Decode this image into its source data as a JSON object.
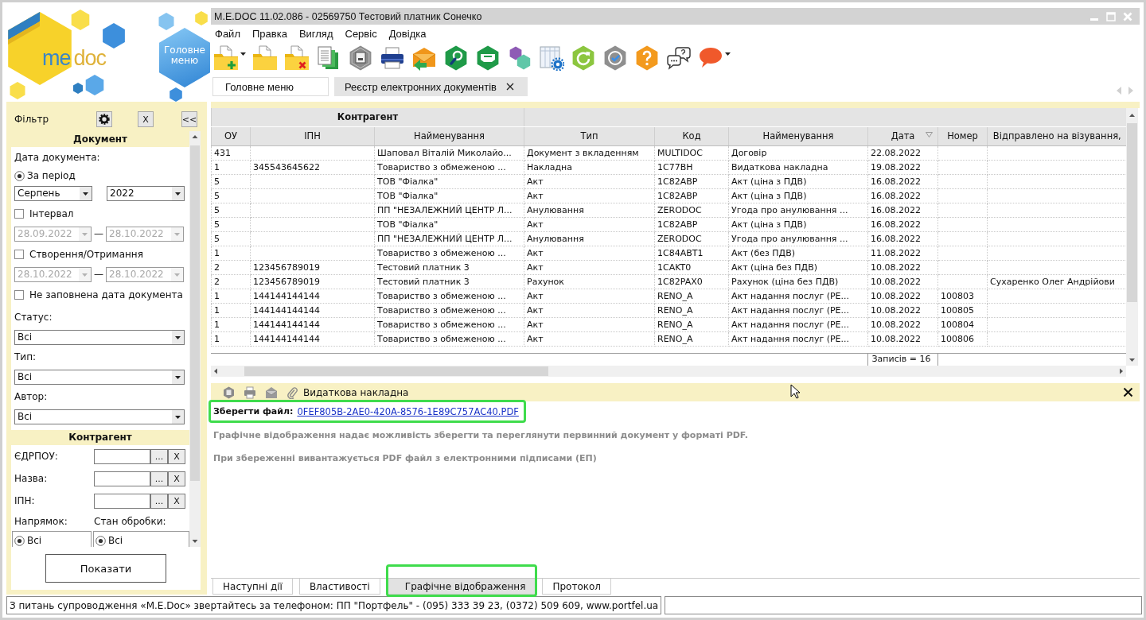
{
  "logo": {
    "words": [
      "me",
      "doc"
    ]
  },
  "main_menu_button": {
    "label": "Головне меню"
  },
  "filter": {
    "title": "Фільтр",
    "clear_button": "X",
    "collapse_button": "<<",
    "document_section": {
      "title": "Документ",
      "date_label": "Дата документа:",
      "period": {
        "label": "За період",
        "selected": true,
        "month": "Серпень",
        "year": "2022"
      },
      "ranges": [
        {
          "label": "Інтервал",
          "checked": false,
          "disabled": true,
          "from": "28.09.2022",
          "separator": "—",
          "to": "28.10.2022"
        },
        {
          "label": "Створення/Отримання",
          "checked": false,
          "disabled": true,
          "from": "28.10.2022",
          "separator": "—",
          "to": "28.10.2022"
        }
      ],
      "empty_date": {
        "label": "Не заповнена дата документа",
        "checked": false
      },
      "selects": [
        {
          "label": "Статус:",
          "value": "Всі"
        },
        {
          "label": "Тип:",
          "value": "Всі"
        },
        {
          "label": "Автор:",
          "value": "Всі"
        }
      ]
    },
    "counterparty_section": {
      "title": "Контрагент",
      "fields": [
        {
          "label": "ЄДРПОУ:",
          "browse_button": "...",
          "clear_button": "X"
        },
        {
          "label": "Назва:",
          "browse_button": "...",
          "clear_button": "X"
        },
        {
          "label": "ІПН:",
          "browse_button": "...",
          "clear_button": "X"
        }
      ],
      "option_groups": [
        {
          "label": "Напрямок:",
          "options": [
            {
              "label": "Всі",
              "selected": true
            }
          ]
        },
        {
          "label": "Стан обробки:",
          "options": [
            {
              "label": "Всі",
              "selected": true
            }
          ]
        }
      ]
    },
    "show_button": "Показати"
  },
  "window": {
    "title": "M.E.DOC 11.02.086 - 02569750 Тестовий платник Сонечко"
  },
  "menu": [
    "Файл",
    "Правка",
    "Вигляд",
    "Сервіс",
    "Довідка"
  ],
  "tabs": [
    {
      "label": "Головне меню",
      "selected": false,
      "closable": false
    },
    {
      "label": "Реєстр електронних документів",
      "selected": true,
      "closable": true
    }
  ],
  "table": {
    "column_groups": [
      {
        "label": "Контрагент",
        "columns": [
          {
            "label": "ОУ",
            "sorted": false
          },
          {
            "label": "ІПН",
            "sorted": false
          },
          {
            "label": "Найменування",
            "sorted": false
          }
        ]
      },
      {
        "columns": [
          {
            "label": "Тип",
            "sorted": false
          },
          {
            "label": "Код",
            "sorted": false
          },
          {
            "label": "Найменування",
            "sorted": false
          },
          {
            "label": "Дата",
            "sorted": true
          },
          {
            "label": "Номер",
            "sorted": false
          },
          {
            "label": "Відправлено на візування,",
            "sorted": false
          }
        ]
      }
    ],
    "rows": [
      {
        "column_1": "431",
        "counterparty_name": "Шаповал Віталій Миколайо...",
        "type": "Документ з вкладенням",
        "code": "MULTIDOC",
        "document_name": "Договір",
        "date": "22.08.2022"
      },
      {
        "column_1": "1",
        "ipn": "345543645622",
        "counterparty_name": "Товариство з обмеженою ...",
        "type": "Накладна",
        "code": "1C77BH",
        "document_name": "Видаткова накладна",
        "date": "19.08.2022"
      },
      {
        "column_1": "5",
        "counterparty_name": "ТОВ \"Фіалка\"",
        "type": "Акт",
        "code": "1C82ABP",
        "document_name": "Акт (ціна з ПДВ)",
        "date": "16.08.2022"
      },
      {
        "column_1": "5",
        "counterparty_name": "ТОВ \"Фіалка\"",
        "type": "Акт",
        "code": "1C82ABP",
        "document_name": "Акт (ціна з ПДВ)",
        "date": "16.08.2022"
      },
      {
        "column_1": "5",
        "counterparty_name": "ПП \"НЕЗАЛЕЖНИЙ ЦЕНТР Л...",
        "type": "Анулювання",
        "code": "ZERODOC",
        "document_name": "Угода про анулювання ...",
        "date": "16.08.2022"
      },
      {
        "column_1": "5",
        "counterparty_name": "ТОВ \"Фіалка\"",
        "type": "Акт",
        "code": "1C82ABP",
        "document_name": "Акт (ціна з ПДВ)",
        "date": "16.08.2022"
      },
      {
        "column_1": "5",
        "counterparty_name": "ПП \"НЕЗАЛЕЖНИЙ ЦЕНТР Л...",
        "type": "Анулювання",
        "code": "ZERODOC",
        "document_name": "Угода про анулювання ...",
        "date": "16.08.2022"
      },
      {
        "column_1": "1",
        "counterparty_name": "Товариство з обмеженою ...",
        "type": "Акт",
        "code": "1C84ABT1",
        "document_name": "Акт (без ПДВ)",
        "date": "11.08.2022"
      },
      {
        "column_1": "2",
        "ipn": "123456789019",
        "counterparty_name": "Тестовий платник 3",
        "type": "Акт",
        "code": "1CAKT0",
        "document_name": "Акт (ціна без ПДВ)",
        "date": "10.08.2022"
      },
      {
        "column_1": "2",
        "ipn": "123456789019",
        "counterparty_name": "Тестовий платник 3",
        "type": "Рахунок",
        "code": "1C82PAX0",
        "document_name": "Рахунок (ціна без ПДВ)",
        "date": "10.08.2022",
        "sent_for_approval": "Сухаренко Олег Андрійови"
      },
      {
        "column_1": "1",
        "ipn": "144144144144",
        "counterparty_name": "Товариство з обмеженою ...",
        "type": "Акт",
        "code": "RENO_A",
        "document_name": "Акт надання послуг (РЕ...",
        "date": "10.08.2022",
        "number": "100803"
      },
      {
        "column_1": "1",
        "ipn": "144144144144",
        "counterparty_name": "Товариство з обмеженою ...",
        "type": "Акт",
        "code": "RENO_A",
        "document_name": "Акт надання послуг (РЕ...",
        "date": "10.08.2022",
        "number": "100805"
      },
      {
        "column_1": "1",
        "ipn": "144144144144",
        "counterparty_name": "Товариство з обмеженою ...",
        "type": "Акт",
        "code": "RENO_A",
        "document_name": "Акт надання послуг (РЕ...",
        "date": "10.08.2022",
        "number": "100804"
      },
      {
        "column_1": "1",
        "ipn": "144144144144",
        "counterparty_name": "Товариство з обмеженою ...",
        "type": "Акт",
        "code": "RENO_A",
        "document_name": "Акт надання послуг (РЕ...",
        "date": "10.08.2022",
        "number": "100806"
      }
    ],
    "footer": {
      "record_count": "Записів = 16"
    }
  },
  "detail": {
    "title": "Видаткова накладна",
    "save_file": {
      "label": "Зберегти файл:",
      "link": "0FEF805B-2AE0-420A-8576-1E89C757AC40.PDF",
      "highlighted": true
    },
    "notes": [
      "Графічне відображення надає можливість зберегти та переглянути первинний документ у форматі PDF.",
      "При збереженні вивантажується PDF файл з електронними підписами (ЕП)"
    ],
    "tabs": [
      {
        "label": "Наступні дії",
        "selected": false,
        "highlighted": false
      },
      {
        "label": "Властивості",
        "selected": false,
        "highlighted": false
      },
      {
        "label": "Графічне відображення",
        "selected": true,
        "highlighted": true
      },
      {
        "label": "Протокол",
        "selected": false,
        "highlighted": false
      }
    ]
  },
  "status_bar": {
    "message": "З питань супроводження «M.E.Doc» звертайтесь за телефоном: ПП \"Портфель\" - (095) 333 39 23, (0372) 509 609, www.portfel.ua"
  }
}
